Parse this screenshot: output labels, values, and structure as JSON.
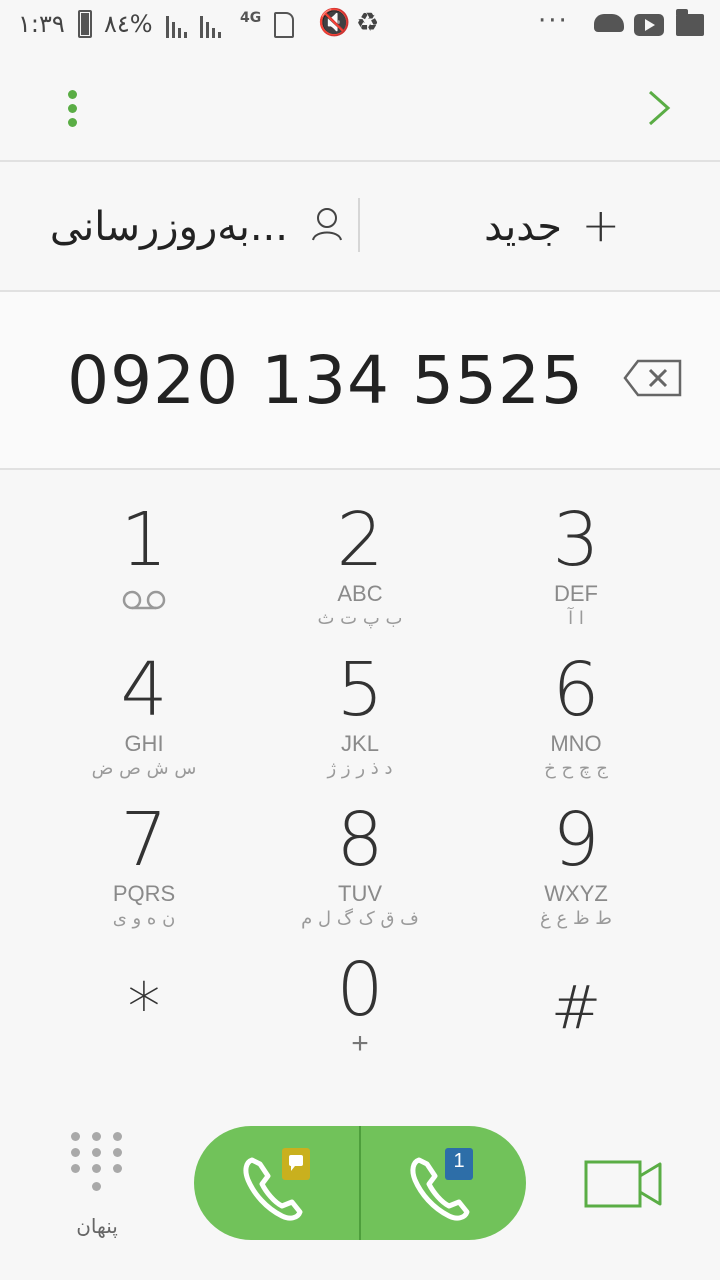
{
  "status_bar": {
    "time": "١:٣٩",
    "battery_percent": "٨٤%",
    "network": "4G",
    "overflow": "···"
  },
  "header": {
    "update_label": "بەروزرسانی...",
    "create_label": "جدید"
  },
  "dialer": {
    "number": "0920 134 5525"
  },
  "keypad": [
    {
      "digit": "1",
      "letters": "",
      "arabic": ""
    },
    {
      "digit": "2",
      "letters": "ABC",
      "arabic": "ب پ ت ث"
    },
    {
      "digit": "3",
      "letters": "DEF",
      "arabic": "ا آ"
    },
    {
      "digit": "4",
      "letters": "GHI",
      "arabic": "س ش ص ض"
    },
    {
      "digit": "5",
      "letters": "JKL",
      "arabic": "د ذ ر ز ژ"
    },
    {
      "digit": "6",
      "letters": "MNO",
      "arabic": "ج چ ح خ"
    },
    {
      "digit": "7",
      "letters": "PQRS",
      "arabic": "ن ه و ی"
    },
    {
      "digit": "8",
      "letters": "TUV",
      "arabic": "ف ق ک گ ل م"
    },
    {
      "digit": "9",
      "letters": "WXYZ",
      "arabic": "ط ظ ع غ"
    },
    {
      "digit": "*",
      "letters": "",
      "arabic": ""
    },
    {
      "digit": "0",
      "letters": "+",
      "arabic": ""
    },
    {
      "digit": "#",
      "letters": "",
      "arabic": ""
    }
  ],
  "bottom_bar": {
    "hide_label": "پنهان",
    "sim1_badge": "1"
  },
  "colors": {
    "accent_green": "#5aad45",
    "call_green": "#71c25a",
    "sim_yellow": "#c9b01e",
    "sim_blue": "#2d6ea8"
  }
}
